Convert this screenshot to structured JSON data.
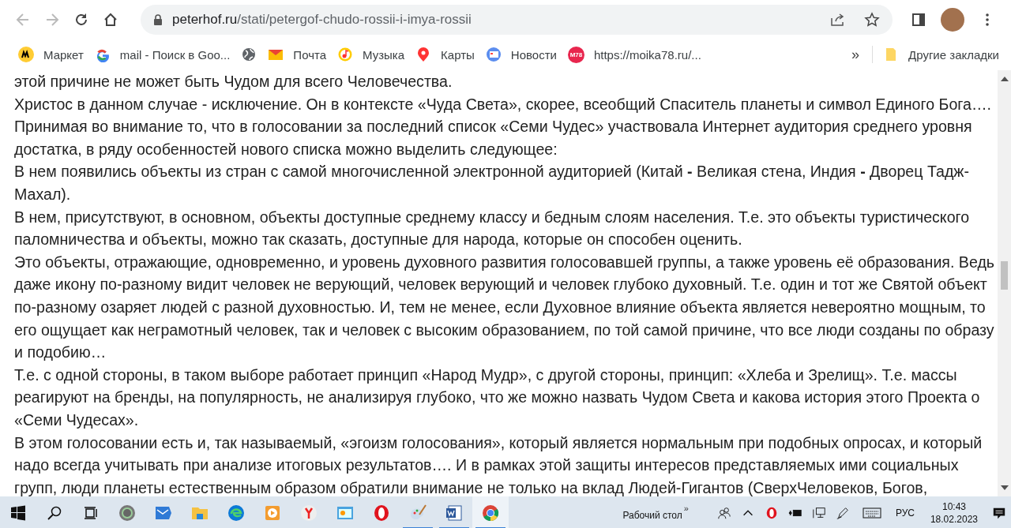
{
  "address_bar": {
    "url_host": "peterhof.ru",
    "url_path": "/stati/petergof-chudo-rossii-i-imya-rossii"
  },
  "bookmarks": [
    {
      "label": "Маркет",
      "kind": "market"
    },
    {
      "label": "mail - Поиск в Goo...",
      "kind": "google"
    },
    {
      "kind": "globe"
    },
    {
      "label": "Почта",
      "kind": "mail"
    },
    {
      "label": "Музыка",
      "kind": "music"
    },
    {
      "label": "Карты",
      "kind": "maps"
    },
    {
      "label": "Новости",
      "kind": "news"
    },
    {
      "label": "https://moika78.ru/...",
      "kind": "m78"
    }
  ],
  "bookmarks_overflow": "»",
  "other_bookmarks": "Другие закладки",
  "m78_badge": "M78",
  "article": {
    "paragraphs": [
      "этой причине не может быть Чудом для всего Человечества.",
      "Христос в данном случае - исключение. Он в контексте «Чуда Света», скорее, всеобщий Спаситель планеты и символ Единого Бога….",
      "Принимая во внимание то, что в голосовании за последний список «Семи Чудес» участвовала Интернет аудитория среднего уровня достатка, в ряду особенностей нового списка можно выделить следующее:",
      "В нем появились объекты из стран с самой многочисленной электронной аудиторией (Китай **-** Великая стена, Индия **-** Дворец Тадж-Махал).",
      "В нем, присутствуют, в основном, объекты доступные среднему классу и бедным слоям населения. Т.е. это объекты туристического паломничества и объекты, можно так сказать, доступные для народа, которые он способен оценить.",
      "Это объекты, отражающие, одновременно, и уровень духовного развития голосовавшей группы, а также уровень её образования. Ведь даже икону по-разному видит человек не верующий, человек верующий и человек глубоко духовный. Т.е. один и тот же Святой объект по-разному озаряет людей с разной духовностью. И, тем не менее, если Духовное влияние объекта является невероятно мощным, то его ощущает как неграмотный человек, так и человек с высоким образованием, по той самой причине, что все люди созданы по образу и подобию…",
      "Т.е. с одной стороны, в таком выборе работает принцип «Народ Мудр», с другой стороны, принцип: «Хлеба и Зрелищ». Т.е. массы реагируют на бренды, на популярность, не анализируя глубоко, что же можно назвать Чудом Света и какова история этого Проекта о «Семи Чудесах».",
      "В этом голосовании есть и, так называемый, «эгоизм голосования», который является нормальным при подобных опросах, и который надо всегда учитывать при анализе итоговых результатов…. И в рамках этой защиты интересов представляемых ими социальных групп, люди планеты естественным образом обратили внимание не только на вклад Людей-Гигантов (СверхЧеловеков, Богов,"
    ]
  },
  "taskbar": {
    "apps": [
      {
        "kind": "media",
        "running": false,
        "selected": false
      },
      {
        "kind": "mail",
        "running": false,
        "selected": false
      },
      {
        "kind": "folder",
        "running": false,
        "selected": false
      },
      {
        "kind": "edge",
        "running": false,
        "selected": false
      },
      {
        "kind": "player",
        "running": false,
        "selected": false
      },
      {
        "kind": "yandex",
        "running": false,
        "selected": false
      },
      {
        "kind": "chart",
        "running": false,
        "selected": false
      },
      {
        "kind": "opera",
        "running": false,
        "selected": false
      },
      {
        "kind": "paint",
        "running": true,
        "selected": false
      },
      {
        "kind": "word",
        "running": true,
        "selected": false
      },
      {
        "kind": "chrome",
        "running": true,
        "selected": true
      }
    ],
    "desktop_label": "Рабочий стол",
    "chevron": "»",
    "language": "РУС",
    "time": "10:43",
    "date": "18.02.2023"
  }
}
